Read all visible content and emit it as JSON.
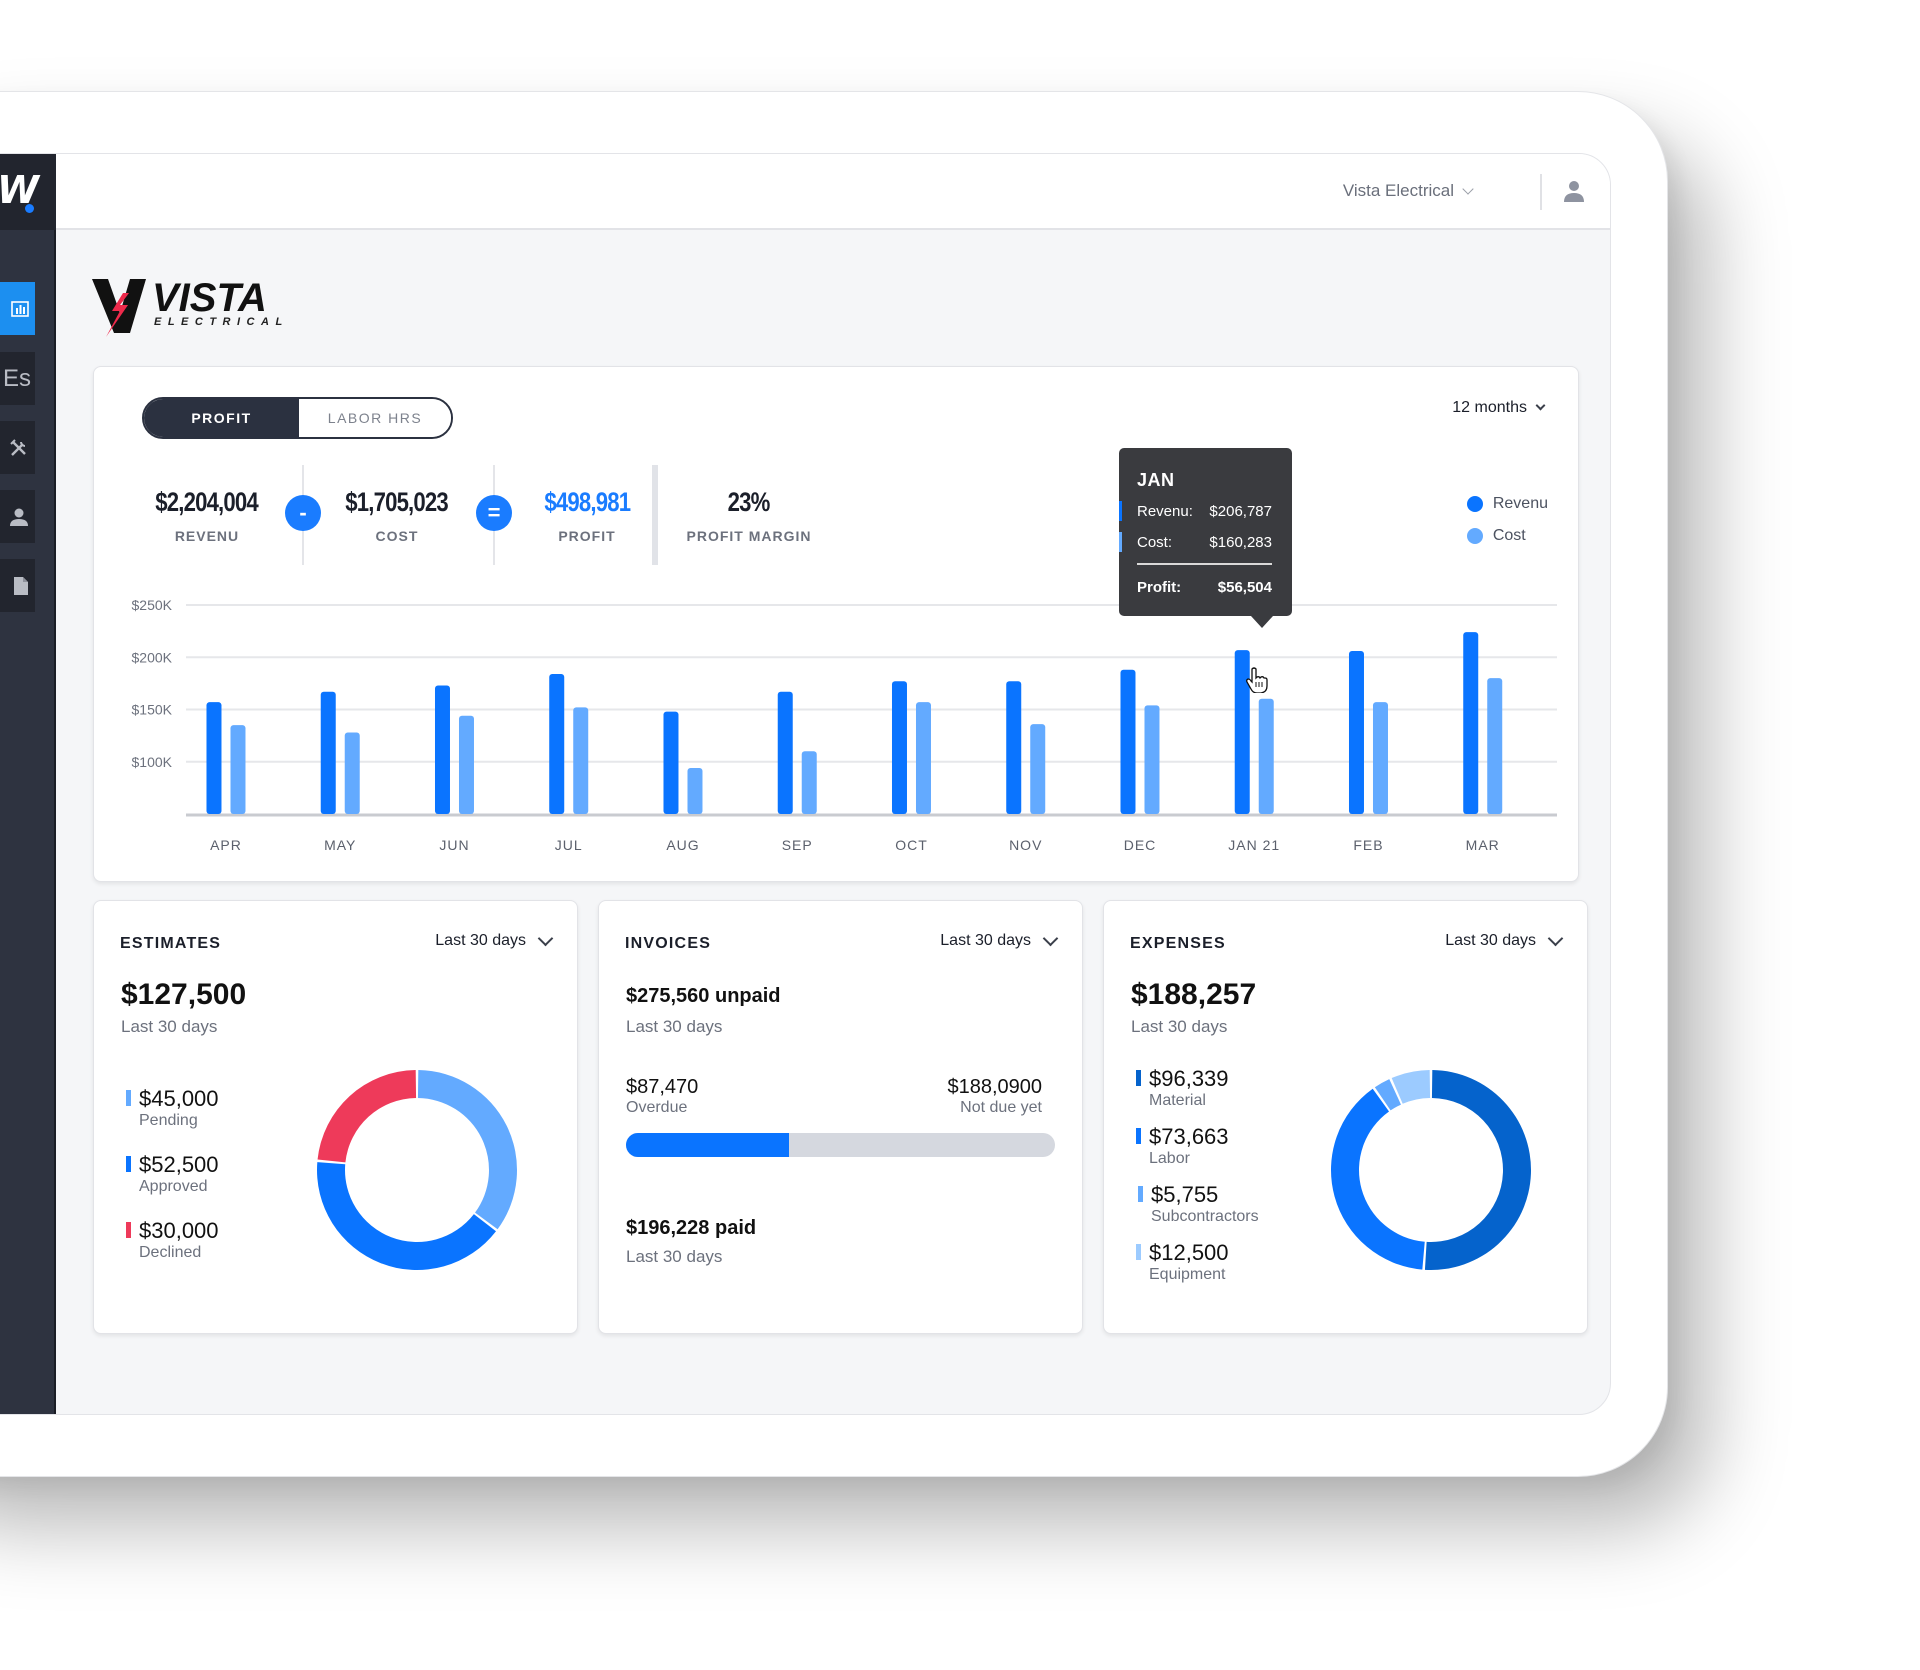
{
  "header": {
    "company_selector": "Vista Electrical",
    "user_icon": "user-icon"
  },
  "sidebar": {
    "brand": "W",
    "items": [
      {
        "icon": "bar-chart-icon",
        "label": "",
        "active": true
      },
      {
        "icon": "estimates-icon",
        "label": "Es",
        "active": false
      },
      {
        "icon": "tools-icon",
        "label": "",
        "active": false
      },
      {
        "icon": "person-icon",
        "label": "",
        "active": false
      },
      {
        "icon": "document-icon",
        "label": "",
        "active": false
      }
    ]
  },
  "logo": {
    "name": "VISTA",
    "subtitle": "ELECTRICAL"
  },
  "profit_card": {
    "tabs": [
      {
        "label": "PROFIT",
        "active": true
      },
      {
        "label": "LABOR HRS",
        "active": false
      }
    ],
    "range": "12 months",
    "kpis": {
      "revenue": {
        "value": "$2,204,004",
        "label": "REVENU"
      },
      "minus_op": "-",
      "cost": {
        "value": "$1,705,023",
        "label": "COST"
      },
      "equals_op": "=",
      "profit": {
        "value": "$498,981",
        "label": "PROFIT"
      },
      "margin": {
        "value": "23%",
        "label": "PROFIT MARGIN"
      }
    },
    "legend": [
      {
        "label": "Revenu",
        "color": "#0a74ff"
      },
      {
        "label": "Cost",
        "color": "#63aaff"
      }
    ],
    "tooltip": {
      "title": "JAN",
      "rows": [
        {
          "label": "Revenu:",
          "value": "$206,787",
          "color": "#0a74ff"
        },
        {
          "label": "Cost:",
          "value": "$160,283",
          "color": "#63aaff"
        }
      ],
      "profit_label": "Profit:",
      "profit_value": "$56,504"
    }
  },
  "chart_data": {
    "type": "bar",
    "title": "",
    "xlabel": "",
    "ylabel": "",
    "categories": [
      "APR",
      "MAY",
      "JUN",
      "JUL",
      "AUG",
      "SEP",
      "OCT",
      "NOV",
      "DEC",
      "JAN 21",
      "FEB",
      "MAR"
    ],
    "series": [
      {
        "name": "Revenu",
        "color": "#0a74ff",
        "values": [
          157000,
          167000,
          173000,
          184000,
          148000,
          167000,
          177000,
          177000,
          188000,
          206787,
          206000,
          224000
        ]
      },
      {
        "name": "Cost",
        "color": "#63aaff",
        "values": [
          135000,
          128000,
          144000,
          152000,
          94000,
          110000,
          157000,
          136000,
          154000,
          160283,
          157000,
          180000
        ]
      }
    ],
    "yticks": [
      100000,
      150000,
      200000,
      250000
    ],
    "ytick_labels": [
      "$100K",
      "$150K",
      "$200K",
      "$250K"
    ],
    "ylim": [
      50000,
      250000
    ],
    "grid": true,
    "legend_position": "top-right",
    "highlighted_category": "JAN 21"
  },
  "estimates": {
    "title": "ESTIMATES",
    "range": "Last 30 days",
    "total": "$127,500",
    "total_sub": "Last 30 days",
    "items": [
      {
        "value": "$45,000",
        "label": "Pending",
        "amount": 45000,
        "color": "#63aaff"
      },
      {
        "value": "$52,500",
        "label": "Approved",
        "amount": 52500,
        "color": "#0a74ff"
      },
      {
        "value": "$30,000",
        "label": "Declined",
        "amount": 30000,
        "color": "#ee3a5a"
      }
    ]
  },
  "invoices": {
    "title": "INVOICES",
    "range": "Last 30 days",
    "unpaid": "$275,560 unpaid",
    "unpaid_sub": "Last 30 days",
    "overdue_value": "$87,470",
    "overdue_label": "Overdue",
    "not_due_value": "$188,0900",
    "not_due_label": "Not due yet",
    "overdue_fraction": 0.38,
    "paid": "$196,228 paid",
    "paid_sub": "Last 30 days"
  },
  "expenses": {
    "title": "EXPENSES",
    "range": "Last 30 days",
    "total": "$188,257",
    "total_sub": "Last 30 days",
    "items": [
      {
        "value": "$96,339",
        "label": "Material",
        "amount": 96339,
        "color": "#0563cc"
      },
      {
        "value": "$73,663",
        "label": "Labor",
        "amount": 73663,
        "color": "#0a74ff"
      },
      {
        "value": "$5,755",
        "label": "Subcontractors",
        "amount": 5755,
        "color": "#63aaff"
      },
      {
        "value": "$12,500",
        "label": "Equipment",
        "amount": 12500,
        "color": "#9ccbff"
      }
    ],
    "donut_order": [
      "Material",
      "Labor",
      "Subcontractors",
      "Equipment"
    ]
  }
}
